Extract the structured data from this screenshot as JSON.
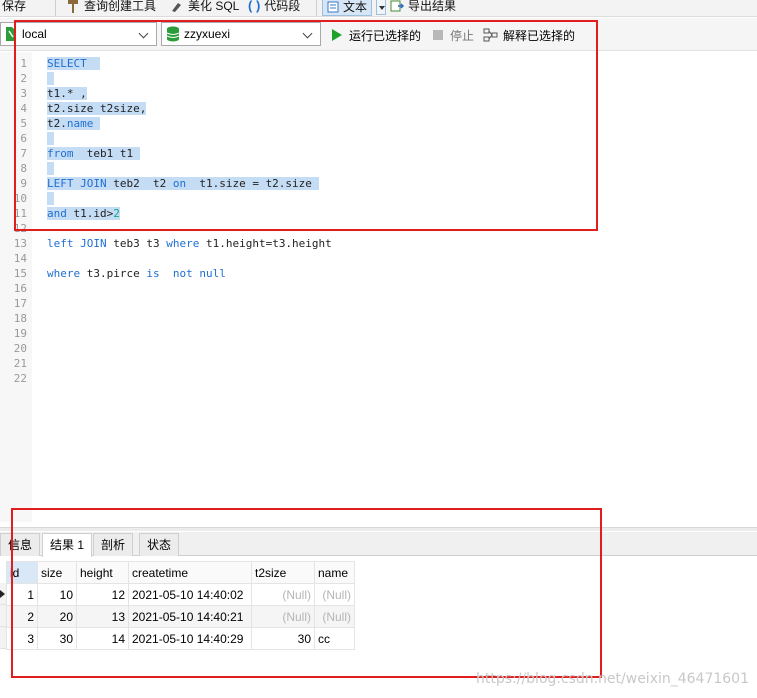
{
  "toolbar": {
    "save": "保存",
    "query_builder": "查询创建工具",
    "beautify": "美化 SQL",
    "snippet": "代码段",
    "text": "文本",
    "export": "导出结果"
  },
  "connection_bar": {
    "connection": "local",
    "database": "zzyxuexi",
    "run_selected": "运行已选择的",
    "stop": "停止",
    "explain_selected": "解释已选择的"
  },
  "editor": {
    "line_numbers": [
      "1",
      "2",
      "3",
      "4",
      "5",
      "6",
      "7",
      "8",
      "9",
      "10",
      "11",
      "12",
      "13",
      "14",
      "15",
      "16",
      "17",
      "18",
      "19",
      "20",
      "21",
      "22"
    ],
    "lines": [
      {
        "n": 1,
        "tokens": [
          {
            "t": "SELECT",
            "k": "kw"
          },
          {
            "t": "  ",
            "k": ""
          }
        ],
        "sel": true
      },
      {
        "n": 2,
        "tokens": [
          {
            "t": " ",
            "k": ""
          }
        ],
        "sel": true
      },
      {
        "n": 3,
        "tokens": [
          {
            "t": "t1.* ,",
            "k": ""
          }
        ],
        "sel": true
      },
      {
        "n": 4,
        "tokens": [
          {
            "t": "t2.size t2size,",
            "k": ""
          }
        ],
        "sel": true
      },
      {
        "n": 5,
        "tokens": [
          {
            "t": "t2.",
            "k": ""
          },
          {
            "t": "name",
            "k": "kw"
          },
          {
            "t": " ",
            "k": ""
          }
        ],
        "sel": true
      },
      {
        "n": 6,
        "tokens": [
          {
            "t": " ",
            "k": ""
          }
        ],
        "sel": true
      },
      {
        "n": 7,
        "tokens": [
          {
            "t": "from",
            "k": "kw"
          },
          {
            "t": "  teb1 t1 ",
            "k": ""
          }
        ],
        "sel": true
      },
      {
        "n": 8,
        "tokens": [
          {
            "t": " ",
            "k": ""
          }
        ],
        "sel": true
      },
      {
        "n": 9,
        "tokens": [
          {
            "t": "LEFT JOIN",
            "k": "kw"
          },
          {
            "t": " teb2  t2 ",
            "k": ""
          },
          {
            "t": "on",
            "k": "kw"
          },
          {
            "t": "  t1.size = t2.size ",
            "k": ""
          }
        ],
        "sel": true
      },
      {
        "n": 10,
        "tokens": [
          {
            "t": " ",
            "k": ""
          }
        ],
        "sel": true
      },
      {
        "n": 11,
        "tokens": [
          {
            "t": "and",
            "k": "kw"
          },
          {
            "t": " t1.id>",
            "k": ""
          },
          {
            "t": "2",
            "k": "num"
          }
        ],
        "sel": true
      },
      {
        "n": 12,
        "tokens": [],
        "sel": false
      },
      {
        "n": 13,
        "tokens": [
          {
            "t": "left JOIN",
            "k": "kw"
          },
          {
            "t": " teb3 t3 ",
            "k": ""
          },
          {
            "t": "where",
            "k": "kw"
          },
          {
            "t": " t1.height=t3.height",
            "k": ""
          }
        ],
        "sel": false
      },
      {
        "n": 14,
        "tokens": [],
        "sel": false
      },
      {
        "n": 15,
        "tokens": [
          {
            "t": "where",
            "k": "kw"
          },
          {
            "t": " t3.pirce ",
            "k": ""
          },
          {
            "t": "is",
            "k": "kw"
          },
          {
            "t": "  ",
            "k": ""
          },
          {
            "t": "not null",
            "k": "kw"
          }
        ],
        "sel": false
      }
    ]
  },
  "result_tabs": [
    {
      "label": "信息",
      "active": false
    },
    {
      "label": "结果 1",
      "active": true
    },
    {
      "label": "剖析",
      "active": false
    },
    {
      "label": "状态",
      "active": false
    }
  ],
  "result_grid": {
    "columns": [
      "id",
      "size",
      "height",
      "createtime",
      "t2size",
      "name"
    ],
    "rows": [
      [
        "1",
        "10",
        "12",
        "2021-05-10 14:40:02",
        "(Null)",
        "(Null)"
      ],
      [
        "2",
        "20",
        "13",
        "2021-05-10 14:40:21",
        "(Null)",
        "(Null)"
      ],
      [
        "3",
        "30",
        "14",
        "2021-05-10 14:40:29",
        "30",
        "cc"
      ]
    ]
  },
  "watermark": "https://blog.csdn.net/weixin_46471601",
  "colors": {
    "selection": "#c5dcf5",
    "keyword": "#1f6fd2",
    "number": "#11a58a",
    "annotation": "#e01e1e",
    "run_icon": "#1fa32c",
    "database_icon": "#2a9d3a"
  }
}
